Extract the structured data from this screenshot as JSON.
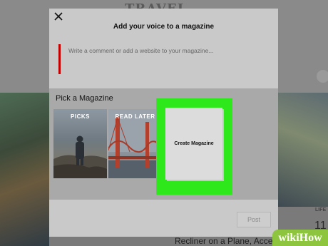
{
  "background": {
    "brand_text": "TRAVEL",
    "side_label": "LIFE",
    "side_number": "11",
    "story_headline": "Recliner on a Plane, Acce"
  },
  "modal": {
    "title": "Add your voice to a magazine",
    "comment_placeholder": "Write a comment or add a website to your magazine...",
    "pick_title": "Pick a Magazine",
    "tiles": [
      {
        "label": "PICKS"
      },
      {
        "label": "READ LATER"
      },
      {
        "label": "Create Magazine"
      }
    ],
    "post_label": "Post",
    "highlight_color": "#2ee81b",
    "accent_color": "#c00000"
  },
  "watermark": "wikiHow"
}
